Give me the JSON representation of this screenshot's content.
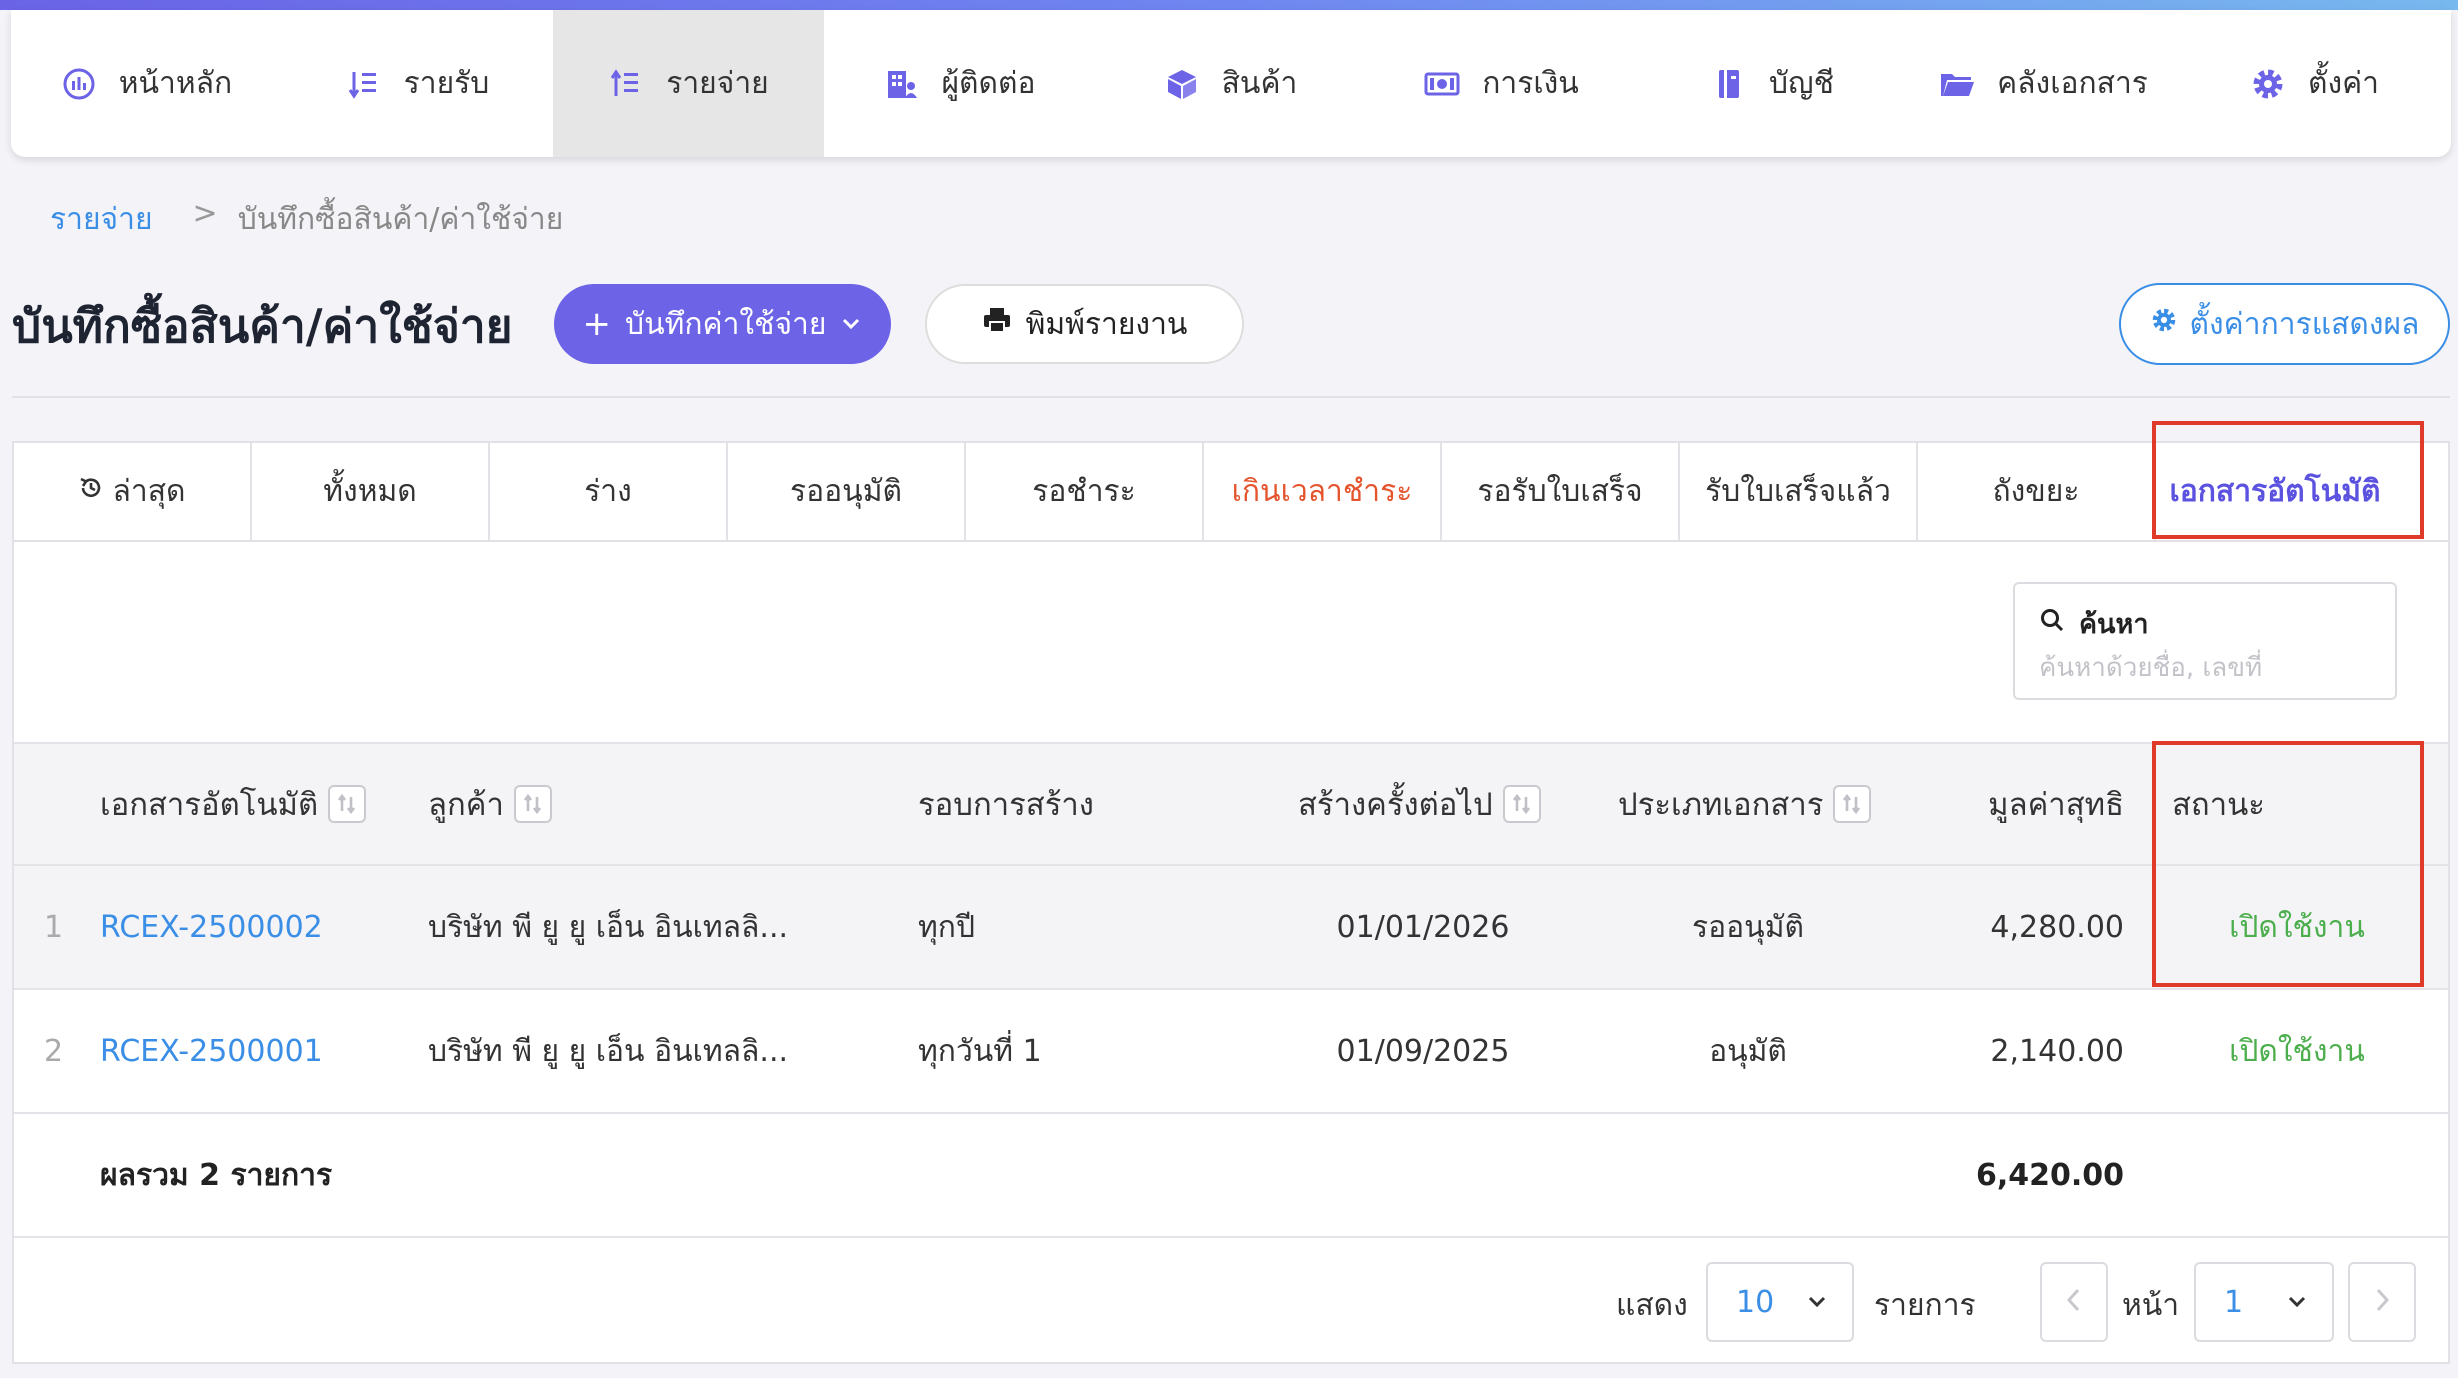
{
  "nav": {
    "items": [
      {
        "label": "หน้าหลัก",
        "icon": "dashboard-icon"
      },
      {
        "label": "รายรับ",
        "icon": "income-list-icon"
      },
      {
        "label": "รายจ่าย",
        "icon": "expense-list-icon",
        "active": true
      },
      {
        "label": "ผู้ติดต่อ",
        "icon": "contacts-building-icon"
      },
      {
        "label": "สินค้า",
        "icon": "product-box-icon"
      },
      {
        "label": "การเงิน",
        "icon": "money-icon"
      },
      {
        "label": "บัญชี",
        "icon": "accounting-book-icon"
      },
      {
        "label": "คลังเอกสาร",
        "icon": "folder-icon"
      },
      {
        "label": "ตั้งค่า",
        "icon": "gear-icon"
      }
    ]
  },
  "breadcrumb": {
    "parent": "รายจ่าย",
    "separator": ">",
    "current": "บันทึกซื้อสินค้า/ค่าใช้จ่าย"
  },
  "page": {
    "title": "บันทึกซื้อสินค้า/ค่าใช้จ่าย",
    "add_button": "บันทึกค่าใช้จ่าย",
    "print_button": "พิมพ์รายงาน",
    "display_settings_button": "ตั้งค่าการแสดงผล"
  },
  "tabs": [
    {
      "label": "ล่าสุด",
      "icon": "history-icon"
    },
    {
      "label": "ทั้งหมด"
    },
    {
      "label": "ร่าง"
    },
    {
      "label": "รออนุมัติ"
    },
    {
      "label": "รอชำระ"
    },
    {
      "label": "เกินเวลาชำระ",
      "color": "#e4542d"
    },
    {
      "label": "รอรับใบเสร็จ"
    },
    {
      "label": "รับใบเสร็จแล้ว"
    },
    {
      "label": "ถังขยะ"
    },
    {
      "label": "เอกสารอัตโนมัติ",
      "active": true
    }
  ],
  "search": {
    "label": "ค้นหา",
    "placeholder": "ค้นหาด้วยชื่อ, เลขที่",
    "value": ""
  },
  "table": {
    "headers": {
      "doc": "เอกสารอัตโนมัติ",
      "customer": "ลูกค้า",
      "cycle": "รอบการสร้าง",
      "next": "สร้างครั้งต่อไป",
      "type": "ประเภทเอกสาร",
      "amount": "มูลค่าสุทธิ",
      "status": "สถานะ"
    },
    "rows": [
      {
        "no": "1",
        "doc": "RCEX-2500002",
        "customer": "บริษัท พี ยู ยู เอ็น อินเทลลิ...",
        "cycle": "ทุกปี",
        "next": "01/01/2026",
        "type": "รออนุมัติ",
        "amount": "4,280.00",
        "status": "เปิดใช้งาน"
      },
      {
        "no": "2",
        "doc": "RCEX-2500001",
        "customer": "บริษัท พี ยู ยู เอ็น อินเทลลิ...",
        "cycle": "ทุกวันที่ 1",
        "next": "01/09/2025",
        "type": "อนุมัติ",
        "amount": "2,140.00",
        "status": "เปิดใช้งาน"
      }
    ],
    "total_label": "ผลรวม 2 รายการ",
    "total_amount": "6,420.00"
  },
  "pagination": {
    "show_label": "แสดง",
    "page_size": "10",
    "items_label": "รายการ",
    "page_label": "หน้า",
    "page": "1"
  },
  "colors": {
    "accent": "#6c63e6",
    "link": "#3a8ee6",
    "status_active": "#4cae4c",
    "overdue": "#e4542d",
    "highlight": "#e03a2b"
  }
}
